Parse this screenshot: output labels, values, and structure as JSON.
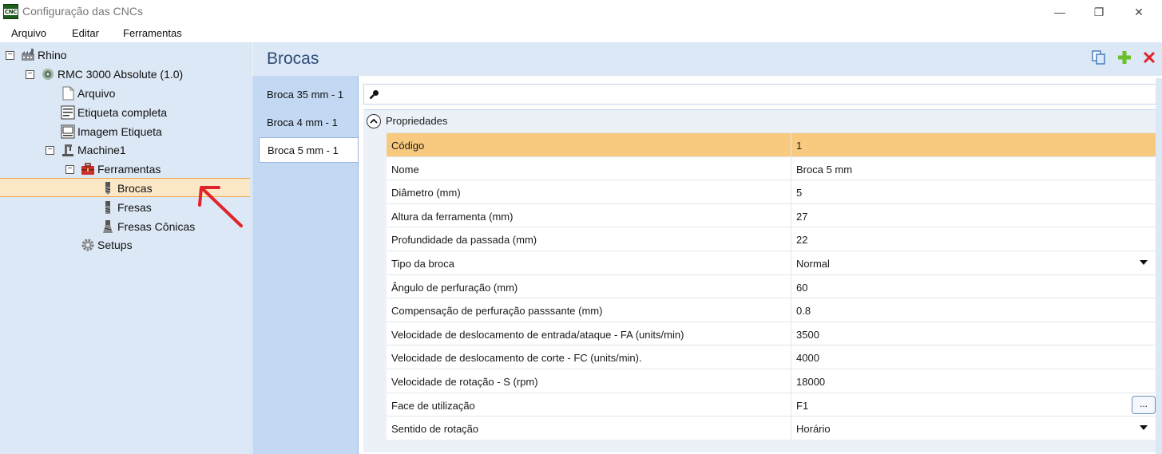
{
  "window": {
    "title": "Configuração das CNCs",
    "app_icon_text": "CNC",
    "minimize": "—",
    "maximize": "❐",
    "close": "✕"
  },
  "menu": [
    "Arquivo",
    "Editar",
    "Ferramentas"
  ],
  "tree": {
    "items": [
      {
        "label": "Rhino",
        "icon": "factory-icon"
      },
      {
        "label": "RMC 3000 Absolute (1.0)",
        "icon": "cnc-machine-icon"
      },
      {
        "label": "Arquivo",
        "icon": "document-icon"
      },
      {
        "label": "Etiqueta completa",
        "icon": "label-icon"
      },
      {
        "label": "Imagem Etiqueta",
        "icon": "image-label-icon"
      },
      {
        "label": "Machine1",
        "icon": "machine-icon"
      },
      {
        "label": "Ferramentas",
        "icon": "toolbox-icon"
      },
      {
        "label": "Brocas",
        "icon": "drill-bit-icon"
      },
      {
        "label": "Fresas",
        "icon": "mill-icon"
      },
      {
        "label": "Fresas Cônicas",
        "icon": "conical-mill-icon"
      },
      {
        "label": "Setups",
        "icon": "gear-icon"
      }
    ],
    "selected": "Brocas"
  },
  "section": {
    "title": "Brocas",
    "actions": [
      {
        "name": "copy-icon"
      },
      {
        "name": "add-icon"
      },
      {
        "name": "delete-icon"
      }
    ]
  },
  "tabs": [
    "Broca 35 mm - 1",
    "Broca 4 mm - 1",
    "Broca 5 mm - 1"
  ],
  "active_tab": "Broca 5 mm - 1",
  "search": {
    "placeholder": ""
  },
  "category": "Propriedades",
  "properties": [
    {
      "name": "Código",
      "value": "1"
    },
    {
      "name": "Nome",
      "value": "Broca 5 mm"
    },
    {
      "name": "Diâmetro (mm)",
      "value": "5"
    },
    {
      "name": "Altura da ferramenta (mm)",
      "value": "27"
    },
    {
      "name": "Profundidade da passada (mm)",
      "value": "22"
    },
    {
      "name": "Tipo da broca",
      "value": "Normal"
    },
    {
      "name": "Ângulo de perfuração (mm)",
      "value": "60"
    },
    {
      "name": "Compensação de perfuração passsante (mm)",
      "value": "0.8"
    },
    {
      "name": "Velocidade de deslocamento de entrada/ataque - FA (units/min)",
      "value": "3500"
    },
    {
      "name": "Velocidade de deslocamento de corte - FC (units/min).",
      "value": "4000"
    },
    {
      "name": "Velocidade de rotação - S (rpm)",
      "value": "18000"
    },
    {
      "name": "Face de utilização",
      "value": "F1"
    },
    {
      "name": "Sentido de rotação",
      "value": "Horário"
    }
  ],
  "ellipsis_label": "...",
  "colors": {
    "selection": "#f7ca80",
    "tree_bg": "#dce8f5",
    "title": "#2b4c7a",
    "arrow": "#e0242a"
  }
}
